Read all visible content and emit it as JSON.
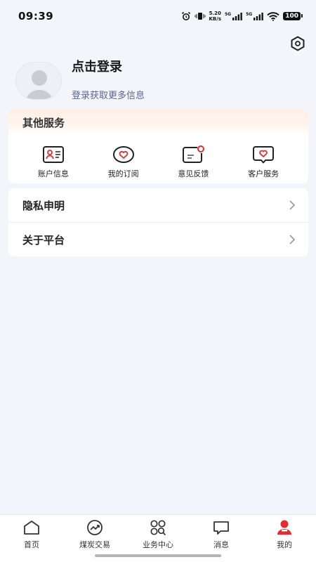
{
  "status_bar": {
    "time": "09:39",
    "net_speed_value": "5.20",
    "net_speed_unit": "KB/s",
    "signal1_label": "5G",
    "signal2_label": "5G",
    "battery": "100"
  },
  "profile": {
    "title": "点击登录",
    "subtitle": "登录获取更多信息"
  },
  "services": {
    "title": "其他服务",
    "items": [
      {
        "label": "账户信息",
        "icon": "account-card-icon"
      },
      {
        "label": "我的订阅",
        "icon": "heart-subscription-icon"
      },
      {
        "label": "意见反馈",
        "icon": "feedback-icon"
      },
      {
        "label": "客户服务",
        "icon": "customer-service-icon"
      }
    ]
  },
  "menu": {
    "items": [
      {
        "label": "隐私申明"
      },
      {
        "label": "关于平台"
      }
    ]
  },
  "tab_bar": {
    "items": [
      {
        "label": "首页",
        "icon": "home-icon"
      },
      {
        "label": "煤炭交易",
        "icon": "trade-chart-icon"
      },
      {
        "label": "业务中心",
        "icon": "business-grid-icon"
      },
      {
        "label": "消息",
        "icon": "message-icon"
      },
      {
        "label": "我的",
        "icon": "user-icon",
        "active": true
      }
    ]
  },
  "colors": {
    "accent_red": "#e8292f",
    "subtitle_blue": "#5b6690",
    "page_bg": "#f3f5fa"
  }
}
